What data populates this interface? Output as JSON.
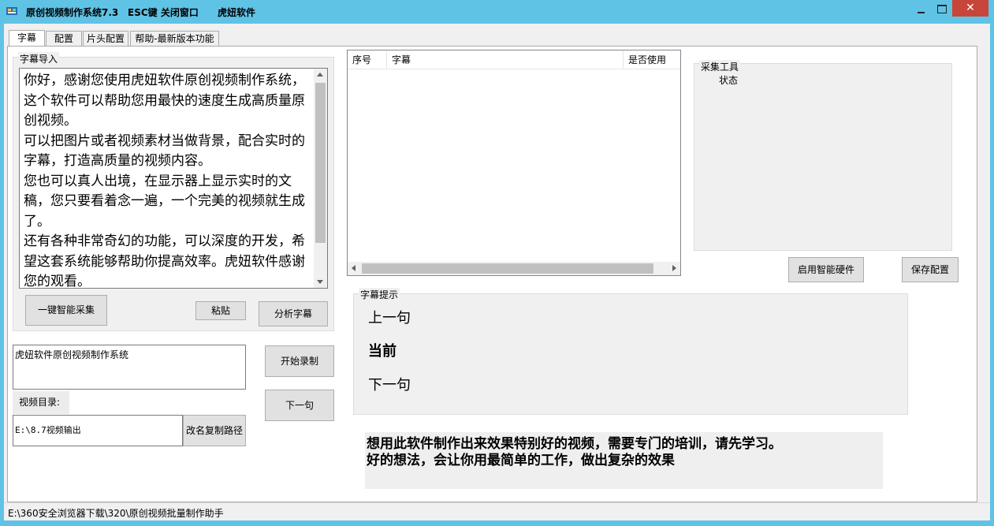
{
  "window": {
    "app_title": "原创视频制作系统7.3",
    "esc_hint": "ESC键 关闭窗口",
    "company": "虎妞软件",
    "close_label": "✕",
    "accent_color": "#5fc3e6"
  },
  "tabs": [
    {
      "label": "字幕",
      "active": true
    },
    {
      "label": "配置",
      "active": false
    },
    {
      "label": "片头配置",
      "active": false
    },
    {
      "label": "帮助-最新版本功能",
      "active": false
    }
  ],
  "subtitle_import": {
    "group_title": "字幕导入",
    "text": "你好，感谢您使用虎妞软件原创视频制作系统，这个软件可以帮助您用最快的速度生成高质量原创视频。\n可以把图片或者视频素材当做背景，配合实时的字幕，打造高质量的视频内容。\n您也可以真人出境，在显示器上显示实时的文稿，您只要看着念一遍，一个完美的视频就生成了。\n还有各种非常奇幻的功能，可以深度的开发，希望这套系统能够帮助你提高效率。虎妞软件感谢您的观看。",
    "one_click_collect": "一键智能采集",
    "paste": "粘贴",
    "analyze": "分析字幕"
  },
  "subtitle_list": {
    "columns": [
      "序号",
      "字幕",
      "是否使用"
    ],
    "rows": []
  },
  "collect_tool": {
    "group_title": "采集工具",
    "status_label": "状态",
    "enable_hardware": "启用智能硬件",
    "save_config": "保存配置"
  },
  "project": {
    "name_value": "虎妞软件原创视频制作系统",
    "start_record": "开始录制",
    "next_sentence": "下一句",
    "video_dir_label": "视频目录:",
    "video_dir_value": "E:\\8.7视频输出",
    "rename_copy_path": "改名复制路径"
  },
  "subtitle_prompt": {
    "group_title": "字幕提示",
    "previous": "上一句",
    "current": "当前",
    "next": "下一句"
  },
  "notice": {
    "line1": "想用此软件制作出来效果特别好的视频，需要专门的培训，请先学习。",
    "line2": "好的想法，会让你用最简单的工作，做出复杂的效果"
  },
  "status_bar": {
    "path": "E:\\360安全浏览器下载\\320\\原创视频批量制作助手"
  }
}
